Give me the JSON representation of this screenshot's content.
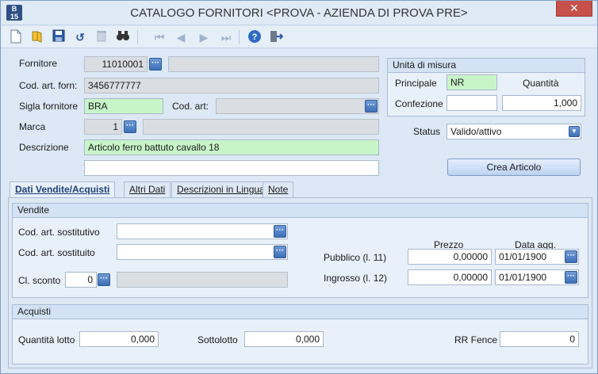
{
  "window": {
    "title": "CATALOGO FORNITORI <PROVA - AZIENDA DI PROVA PRE>",
    "close_label": "✕",
    "app_icon_top": "B",
    "app_icon_bottom": "15"
  },
  "toolbar": {
    "icons": [
      "new-document-icon",
      "open-folder-icon",
      "save-icon",
      "undo-icon",
      "delete-icon",
      "binoculars-icon",
      "first-record-icon",
      "previous-record-icon",
      "next-record-icon",
      "last-record-icon",
      "help-icon",
      "exit-icon"
    ]
  },
  "header": {
    "fornitore_label": "Fornitore",
    "fornitore_value": "11010001",
    "fornitore_name": "",
    "cod_art_forn_label": "Cod. art. forn:",
    "cod_art_forn_value": "3456777777",
    "sigla_label": "Sigla fornitore",
    "sigla_value": "BRA",
    "cod_art_label": "Cod. art:",
    "cod_art_value": "",
    "marca_label": "Marca",
    "marca_value": "1",
    "marca_desc": "",
    "descrizione_label": "Descrizione",
    "descrizione_value": "Articolo ferro battuto cavallo 18",
    "descrizione_extra": ""
  },
  "units": {
    "title": "Unità di misura",
    "principale_label": "Principale",
    "principale_value": "NR",
    "quantita_label": "Quantità",
    "confezione_label": "Confezione",
    "confezione_value": "",
    "quantita_value": "1,000"
  },
  "status": {
    "label": "Status",
    "value": "Valido/attivo"
  },
  "crea_articolo_label": "Crea Articolo",
  "tabs": [
    {
      "label": "Dati Vendite/Acquisti",
      "active": true
    },
    {
      "label": "Altri Dati",
      "active": false
    },
    {
      "label": "Descrizioni in Lingua",
      "active": false
    },
    {
      "label": "Note",
      "active": false
    }
  ],
  "vendite": {
    "title": "Vendite",
    "sostitutivo_label": "Cod. art. sostitutivo",
    "sostitutivo_value": "",
    "sostituito_label": "Cod. art. sostituito",
    "sostituito_value": "",
    "sconto_label": "Cl. sconto",
    "sconto_value": "0",
    "sconto_desc": "",
    "prezzo_header": "Prezzo",
    "data_header": "Data agg.",
    "pubblico_label": "Pubblico (l. 11)",
    "pubblico_prezzo": "0,00000",
    "pubblico_data": "01/01/1900",
    "ingrosso_label": "Ingrosso (l. 12)",
    "ingrosso_prezzo": "0,00000",
    "ingrosso_data": "01/01/1900"
  },
  "acquisti": {
    "title": "Acquisti",
    "lotto_label": "Quantità lotto",
    "lotto_value": "0,000",
    "sottolotto_label": "Sottolotto",
    "sottolotto_value": "0,000",
    "fence_label": "RR Fence",
    "fence_value": "0"
  }
}
